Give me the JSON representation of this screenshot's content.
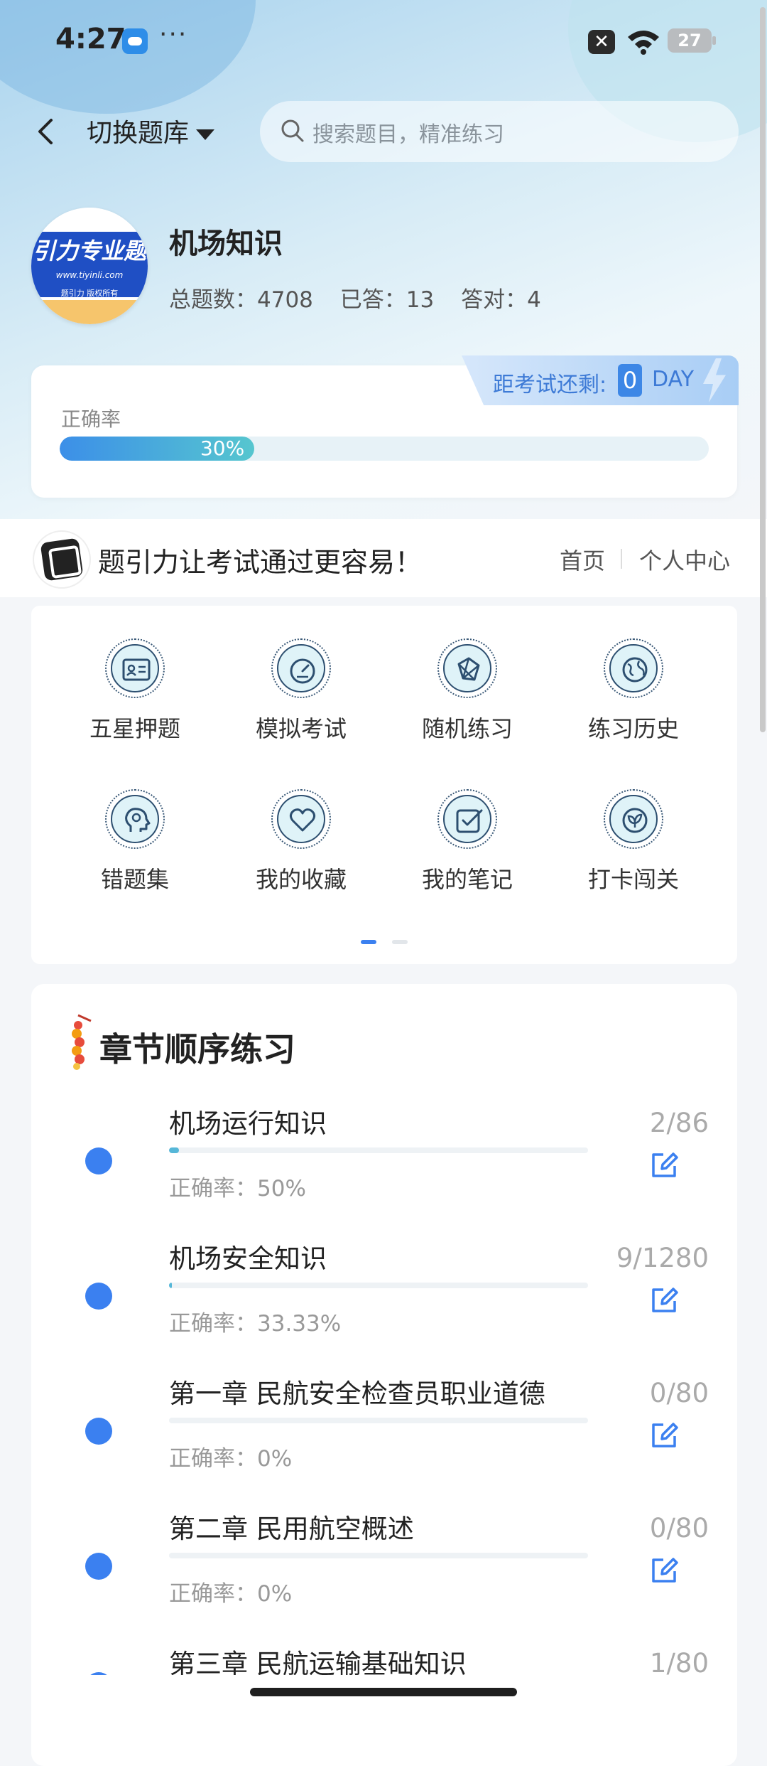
{
  "status_bar": {
    "time": "4:27",
    "more": "···",
    "battery": "27"
  },
  "header": {
    "switch_label": "切换题库",
    "search_placeholder": "搜索题目，精准练习"
  },
  "bank": {
    "logo_brand": "引力专业题",
    "logo_url": "www.tiyinli.com",
    "logo_rights": "题引力 版权所有",
    "name": "机场知识",
    "stats": {
      "total": "总题数：4708",
      "answered": "已答：13",
      "correct": "答对：4"
    }
  },
  "accuracy": {
    "label": "正确率",
    "percent_text": "30%",
    "percent": 30
  },
  "exam_countdown": {
    "label": "距考试还剩:",
    "value": "0",
    "unit": "DAY"
  },
  "banner": {
    "slogan": "题引力让考试通过更容易！",
    "nav_home": "首页",
    "nav_profile": "个人中心"
  },
  "menu": {
    "items": [
      {
        "label": "五星押题",
        "icon": "id-card-icon"
      },
      {
        "label": "模拟考试",
        "icon": "gauge-icon"
      },
      {
        "label": "随机练习",
        "icon": "network-icon"
      },
      {
        "label": "练习历史",
        "icon": "globe-icon"
      },
      {
        "label": "错题集",
        "icon": "head-icon"
      },
      {
        "label": "我的收藏",
        "icon": "heart-icon"
      },
      {
        "label": "我的笔记",
        "icon": "checkbox-icon"
      },
      {
        "label": "打卡闯关",
        "icon": "leaf-icon"
      }
    ],
    "page_count": 2,
    "active_page": 0
  },
  "chapters": {
    "title": "章节顺序练习",
    "items": [
      {
        "name": "机场运行知识",
        "rate": "正确率：50%",
        "count": "2/86",
        "progress": 0.023
      },
      {
        "name": "机场安全知识",
        "rate": "正确率：33.33%",
        "count": "9/1280",
        "progress": 0.007
      },
      {
        "name": "第一章 民航安全检查员职业道德",
        "rate": "正确率：0%",
        "count": "0/80",
        "progress": 0
      },
      {
        "name": "第二章 民用航空概述",
        "rate": "正确率：0%",
        "count": "0/80",
        "progress": 0
      },
      {
        "name": "第三章 民航运输基础知识",
        "rate": "",
        "count": "1/80",
        "progress": 0.0125
      }
    ]
  },
  "colors": {
    "accent": "#3b80f0",
    "progress": "#56b7d8"
  }
}
